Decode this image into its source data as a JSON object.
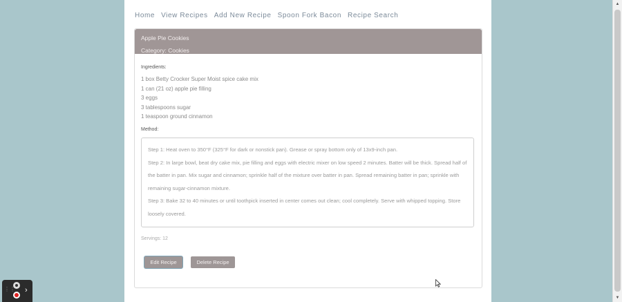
{
  "nav": {
    "items": [
      "Home",
      "View Recipes",
      "Add New Recipe",
      "Spoon Fork Bacon",
      "Recipe Search"
    ]
  },
  "recipe": {
    "title": "Apple Pie Cookies",
    "category": "Category: Cookies",
    "ingredients_label": "Ingredients:",
    "ingredients": [
      "1 box Betty Crocker Super Moist spice cake mix",
      "1 can (21 oz) apple pie filling",
      "3 eggs",
      "3 tablespoons sugar",
      "1 teaspoon ground cinnamon"
    ],
    "method_label": "Method:",
    "method": [
      "Step 1: Heat oven to 350°F (325°F for dark or nonstick pan). Grease or spray bottom only of 13x9-inch pan.",
      "Step 2: In large bowl, beat dry cake mix, pie filling and eggs with electric mixer on low speed 2 minutes. Batter will be thick. Spread half of the batter in pan. Mix sugar and cinnamon; sprinkle half of the mixture over batter in pan. Spread remaining batter in pan; sprinkle with remaining sugar-cinnamon mixture.",
      "Step 3: Bake 32 to 40 minutes or until toothpick inserted in center comes out clean; cool completely. Serve with whipped topping. Store loosely covered."
    ],
    "servings": "Servings: 12"
  },
  "buttons": {
    "edit": "Edit Recipe",
    "delete": "Delete Recipe"
  },
  "icons": {
    "scroll_up": "triangle-up-icon",
    "scroll_down": "triangle-down-icon",
    "recorder_camera": "camera-icon",
    "recorder_record": "record-icon",
    "recorder_expand": "chevron-right-icon",
    "cursor": "mouse-pointer-icon"
  },
  "colors": {
    "background": "#a9c6cb",
    "header": "#a09696",
    "button": "#9e9696",
    "nav_text": "#7b8a99"
  }
}
